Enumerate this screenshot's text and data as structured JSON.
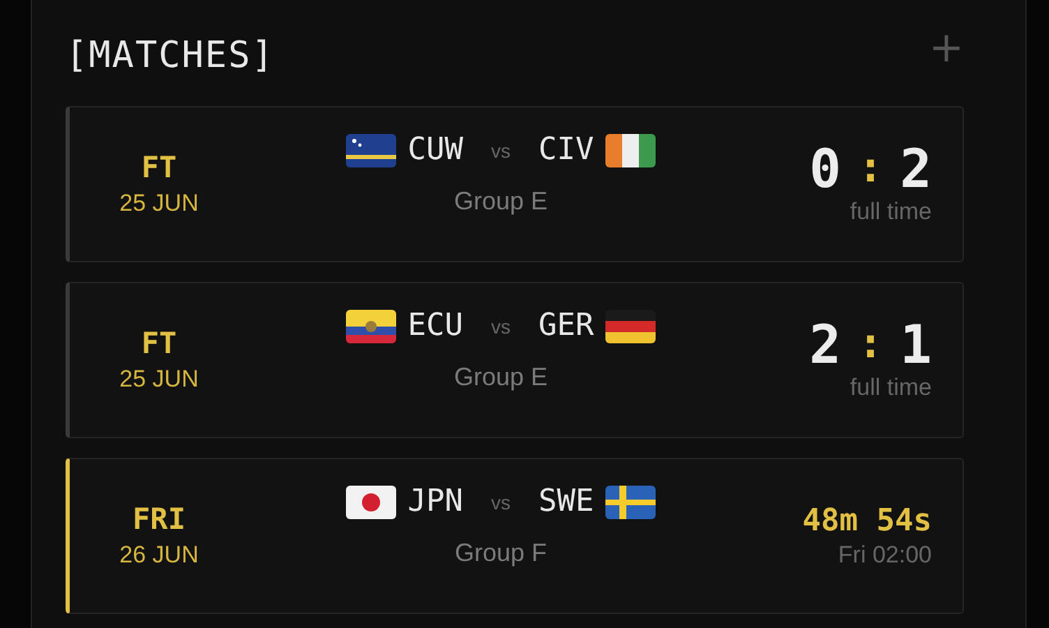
{
  "title": "[MATCHES]",
  "add_button": "+",
  "matches": [
    {
      "kind": "finished",
      "day": "FT",
      "date": "25 JUN",
      "home": {
        "code": "CUW",
        "kind": "curacao"
      },
      "vs": "vs",
      "away": {
        "code": "CIV",
        "kind": "ivorycoast"
      },
      "group": "Group E",
      "score_home": "0",
      "separator": ":",
      "score_away": "2",
      "note": "full time"
    },
    {
      "kind": "finished",
      "day": "FT",
      "date": "25 JUN",
      "home": {
        "code": "ECU",
        "kind": "ecuador"
      },
      "vs": "vs",
      "away": {
        "code": "GER",
        "kind": "germany"
      },
      "group": "Group E",
      "score_home": "2",
      "separator": ":",
      "score_away": "1",
      "note": "full time"
    },
    {
      "kind": "upcoming",
      "day": "FRI",
      "date": "26 JUN",
      "home": {
        "code": "JPN",
        "kind": "japan"
      },
      "vs": "vs",
      "away": {
        "code": "SWE",
        "kind": "sweden"
      },
      "group": "Group F",
      "countdown": "48m 54s",
      "note": "Fri 02:00"
    }
  ]
}
